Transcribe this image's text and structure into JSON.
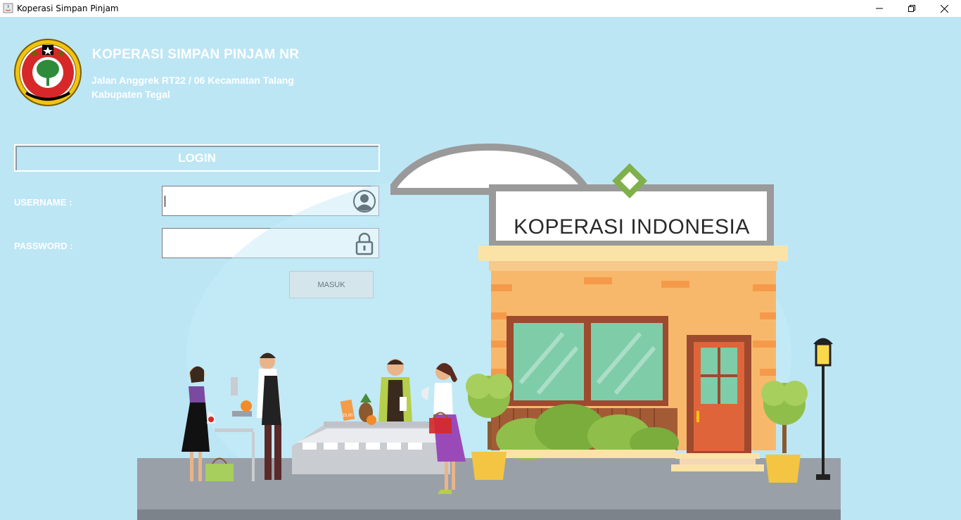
{
  "window": {
    "title": "Koperasi Simpan Pinjam",
    "controls": {
      "minimize": "—",
      "maximize": "❐",
      "close": "✕"
    }
  },
  "header": {
    "org_name": "KOPERASI SIMPAN PINJAM NR",
    "address_line1": "Jalan Anggrek RT22 / 06 Kecamatan Talang",
    "address_line2": "Kabupaten Tegal",
    "logo_icon": "koperasi-indonesia-emblem"
  },
  "login": {
    "title": "LOGIN",
    "username_label": "USERNAME :",
    "username_value": "",
    "username_icon": "user-circle-icon",
    "password_label": "PASSWORD :",
    "password_value": "",
    "password_icon": "lock-icon",
    "submit_label": "MASUK"
  },
  "illustration": {
    "sign_text": "KOPERASI INDONESIA",
    "price_tag": "15.00"
  },
  "colors": {
    "background": "#bde6f5",
    "text_on_bg": "#ffffff",
    "button_bg": "#e1e1e1"
  }
}
